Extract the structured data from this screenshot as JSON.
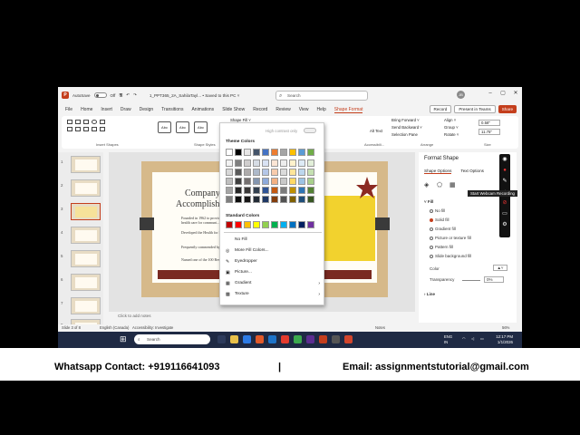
{
  "app": {
    "autosave_label": "AutoSave",
    "autosave_state": "Off",
    "doc_title": "1_PPT365_2A_SahilaTayl... • Saved to this PC ˅",
    "search_placeholder": "Search",
    "user_initials": "JB"
  },
  "tabs": [
    "File",
    "Home",
    "Insert",
    "Draw",
    "Design",
    "Transitions",
    "Animations",
    "Slide Show",
    "Record",
    "Review",
    "View",
    "Help",
    "Shape Format"
  ],
  "tab_actions": {
    "record": "Record",
    "present": "Present in Teams",
    "share": "Share"
  },
  "ribbon": {
    "insert_shapes_label": "Insert Shapes",
    "shape_styles_label": "Shape Styles",
    "style_boxes": [
      "Abc",
      "Abc",
      "Abc"
    ],
    "shape_fill": "Shape Fill ˅",
    "alt_text": "Alt Text",
    "accessibility_label": "Accessibili...",
    "bring_forward": "Bring Forward ˅",
    "send_backward": "Send Backward ˅",
    "selection_pane": "Selection Pane",
    "align": "Align ˅",
    "group": "Group ˅",
    "rotate": "Rotate ˅",
    "arrange_label": "Arrange",
    "height": "0.58\"",
    "width": "11.75\"",
    "size_label": "Size"
  },
  "thumbnails": [
    "1",
    "2",
    "3",
    "4",
    "5",
    "6",
    "7",
    "8"
  ],
  "slide": {
    "title": "Company",
    "title2": "Accomplishm...",
    "bullets": [
      "Founded in 1962 to provide comprehensive health care for communi...",
      "Developed the Health for Life... in 1995",
      "Frequently commended by advocates",
      "Named one of the 100 Best Corporations"
    ]
  },
  "notes_placeholder": "Click to add notes",
  "fill_menu": {
    "high_contrast": "High contrast only",
    "theme_colors_label": "Theme Colors",
    "standard_colors_label": "Standard Colors",
    "items": [
      {
        "icon": "",
        "label": "No Fill"
      },
      {
        "icon": "◎",
        "label": "More Fill Colors..."
      },
      {
        "icon": "✎",
        "label": "Eyedropper"
      },
      {
        "icon": "▣",
        "label": "Picture..."
      },
      {
        "icon": "▦",
        "label": "Gradient",
        "arrow": "›"
      },
      {
        "icon": "▩",
        "label": "Texture",
        "arrow": "›"
      }
    ],
    "theme_top": [
      "#ffffff",
      "#000000",
      "#e7e6e6",
      "#44546a",
      "#4472c4",
      "#ed7d31",
      "#a5a5a5",
      "#ffc000",
      "#5b9bd5",
      "#70ad47"
    ],
    "theme_rows": [
      [
        "#f2f2f2",
        "#7f7f7f",
        "#d0cece",
        "#d6dce4",
        "#d9e2f3",
        "#fbe5d5",
        "#ededed",
        "#fff2cc",
        "#deebf6",
        "#e2efd9"
      ],
      [
        "#d8d8d8",
        "#595959",
        "#aeabab",
        "#adb9ca",
        "#b4c6e7",
        "#f7cbac",
        "#dbdbdb",
        "#fee599",
        "#bdd7ee",
        "#c5e0b3"
      ],
      [
        "#bfbfbf",
        "#3f3f3f",
        "#757070",
        "#8496b0",
        "#8eaadb",
        "#f4b183",
        "#c9c9c9",
        "#ffd965",
        "#9cc3e5",
        "#a8d08d"
      ],
      [
        "#a5a5a5",
        "#262626",
        "#3a3838",
        "#323f4f",
        "#2f5496",
        "#c45911",
        "#7b7b7b",
        "#bf9000",
        "#2e75b5",
        "#538135"
      ],
      [
        "#7f7f7f",
        "#0c0c0c",
        "#171616",
        "#222a35",
        "#1f3864",
        "#833c0b",
        "#525252",
        "#7f6000",
        "#1f4e79",
        "#375623"
      ]
    ],
    "standard": [
      "#c00000",
      "#ff0000",
      "#ffc000",
      "#ffff00",
      "#92d050",
      "#00b050",
      "#00b0f0",
      "#0070c0",
      "#002060",
      "#7030a0"
    ]
  },
  "pane": {
    "title": "Format Shape",
    "tab1": "Shape Options",
    "tab2": "Text Options",
    "fill_section": "Fill",
    "options": [
      "No fill",
      "Solid fill",
      "Gradient fill",
      "Picture or texture fill",
      "Pattern fill",
      "Slide background fill"
    ],
    "selected_index": 1,
    "color_label": "Color",
    "transparency_label": "Transparency",
    "transparency_value": "0%",
    "line_section": "Line"
  },
  "webcam_tooltip": "Start Webcam Recording",
  "status": {
    "slide_info": "Slide 3 of 8",
    "language": "English (Canada)",
    "accessibility": "Accessibility: Investigate",
    "notes": "Notes",
    "zoom": "56%"
  },
  "taskbar": {
    "search": "Search",
    "lang1": "ENG",
    "lang2": "IN",
    "time": "12:17 PM",
    "date": "1/1/2026"
  },
  "caption": {
    "left": "Whatsapp Contact: +919116641093",
    "sep": "|",
    "right": "Email: assignmentstutorial@gmail.com"
  }
}
